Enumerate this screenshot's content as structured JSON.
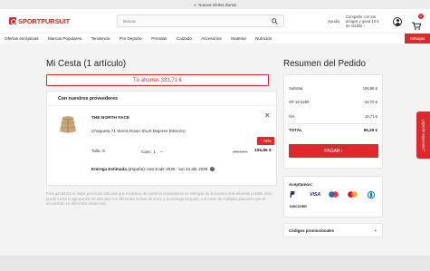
{
  "topbar": {
    "text": "Nuevas ofertas diarias"
  },
  "header": {
    "logo": "SPORTPURSUIT",
    "search_placeholder": "Buscar",
    "help": "Ayuda",
    "promo": "Comparte con tus amigos y gana 10 € de crédito ›",
    "cart_count": "1"
  },
  "nav": {
    "items": [
      "Ofertas exclusivas",
      "Marcas Populares",
      "Tendencia",
      "Por Deporte",
      "Prendas",
      "Calzado",
      "Accesorios",
      "Material",
      "Nutrición"
    ],
    "sale": "Rebajas"
  },
  "cart": {
    "title": "Mi Cesta (1 artículo)",
    "savings": "Tú ahorras 333,71 €",
    "supplier_heading": "Con nuestros proveedores",
    "item": {
      "brand": "THE NORTH FACE",
      "name": "Chaqueta 71 Sierra Down Short Mujeres (Marrón)",
      "size_label": "Talla: S",
      "qty_label": "Cant.: 1",
      "discount": "- 76%",
      "old_price": "440,55 €",
      "new_price": "106,86 €"
    },
    "delivery_label": "Entrega Estimada",
    "delivery_text": "(España): mar 8 abr 2025 - lun 14 abr 2025",
    "disclaimer": "Para garantizar el mejor precio los artículos que recibimos de nuestros proveedores se entregan de la manera más eficiente posible. Esto puede incluir la agrupación de artículos con diferentes fechas de envío y su entrega conjunta, o el envío de múltiples paquetes que se encuentran en diferentes almacenes."
  },
  "summary": {
    "title": "Resumen del Pedido",
    "subtotal_label": "Subtotal",
    "subtotal": "106,86 €",
    "code_label": "SP-10-3290",
    "code_value": "-10,70 €",
    "iva_label": "IVA",
    "iva": "16,71 €",
    "total_label": "TOTAL",
    "total": "96,29 €",
    "pay_button": "PAGAR ›"
  },
  "payments": {
    "title": "Aceptamos:",
    "logos": [
      "PayPal",
      "VISA",
      "Maestro",
      "Mastercard",
      "Diners",
      "DISCOVER"
    ]
  },
  "promo_codes": {
    "label": "Códigos promocionales"
  },
  "help_tab": "¿Necesita ayuda?",
  "colors": {
    "accent": "#e0282c",
    "background": "#f3f3f3"
  }
}
